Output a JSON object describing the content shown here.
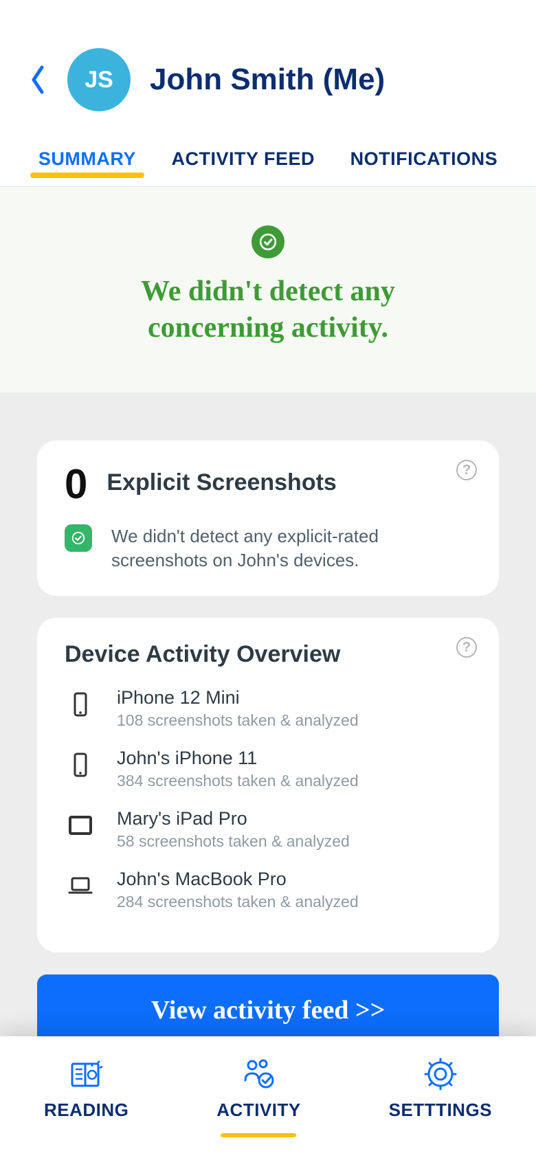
{
  "header": {
    "avatar_initials": "JS",
    "title": "John Smith (Me)"
  },
  "tabs": {
    "summary": "SUMMARY",
    "activity_feed": "ACTIVITY FEED",
    "notifications": "NOTIFICATIONS"
  },
  "status": {
    "message": "We didn't detect any concerning activity."
  },
  "explicit_card": {
    "count": "0",
    "title": "Explicit Screenshots",
    "description": "We didn't detect any explicit-rated screenshots on John's devices."
  },
  "device_card": {
    "title": "Device Activity Overview",
    "devices": [
      {
        "name": "iPhone 12 Mini",
        "sub": "108 screenshots taken & analyzed",
        "icon": "phone"
      },
      {
        "name": "John's iPhone 11",
        "sub": "384 screenshots taken & analyzed",
        "icon": "phone"
      },
      {
        "name": "Mary's iPad Pro",
        "sub": "58 screenshots taken & analyzed",
        "icon": "tablet"
      },
      {
        "name": "John's MacBook Pro",
        "sub": "284 screenshots taken & analyzed",
        "icon": "laptop"
      }
    ]
  },
  "buttons": {
    "view_feed": "View activity feed >>"
  },
  "bottom_nav": {
    "reading": "READING",
    "activity": "ACTIVITY",
    "settings": "SETTTINGS"
  }
}
